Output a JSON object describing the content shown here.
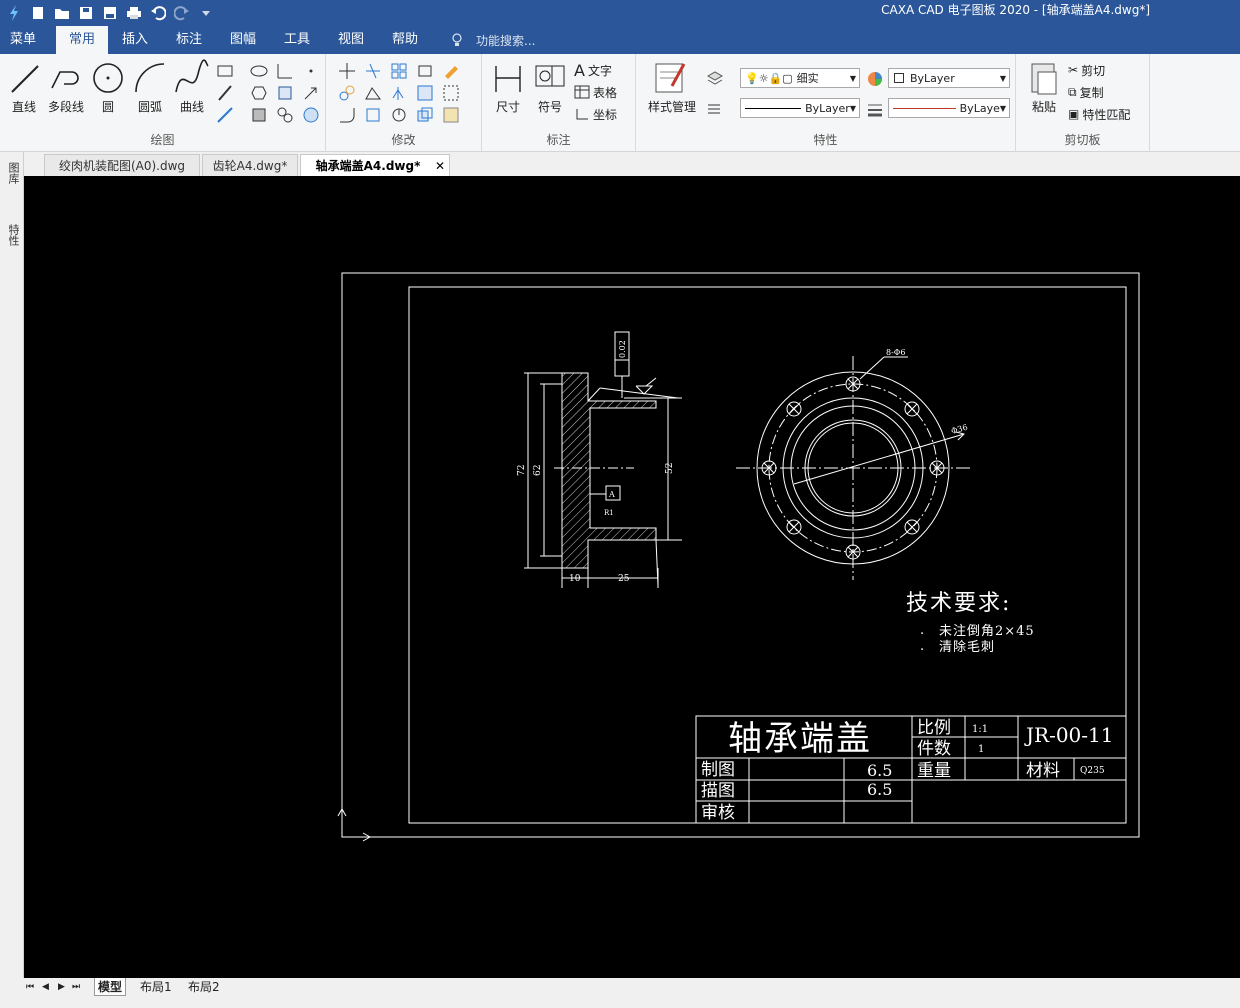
{
  "window": {
    "title": "CAXA CAD 电子图板 2020 - [轴承端盖A4.dwg*]"
  },
  "menu": {
    "items": [
      "菜单",
      "常用",
      "插入",
      "标注",
      "图幅",
      "工具",
      "视图",
      "帮助"
    ],
    "active": "常用",
    "search_placeholder": "功能搜索..."
  },
  "ribbon": {
    "draw": {
      "label": "绘图",
      "line": "直线",
      "polyline": "多段线",
      "circle": "圆",
      "arc": "圆弧",
      "curve": "曲线"
    },
    "modify": {
      "label": "修改"
    },
    "annotate": {
      "label": "标注",
      "dimension": "尺寸",
      "symbol": "符号",
      "text": "文字",
      "table": "表格",
      "coord": "坐标"
    },
    "properties": {
      "label": "特性",
      "style_manager": "样式管理",
      "layer": "细实",
      "color": "ByLayer",
      "linetype": "ByLayer",
      "lineweight": "ByLaye"
    },
    "clipboard": {
      "label": "剪切板",
      "paste": "粘贴",
      "cut": "剪切",
      "copy": "复制",
      "match": "特性匹配"
    }
  },
  "doc_tabs": [
    "绞肉机装配图(A0).dwg",
    "齿轮A4.dwg*",
    "轴承端盖A4.dwg*"
  ],
  "active_doc": "轴承端盖A4.dwg*",
  "side_tabs": [
    "图库",
    "特性"
  ],
  "drawing": {
    "tech_title": "技术要求:",
    "tech_items": [
      "未注倒角2×45",
      "清除毛刺"
    ],
    "part_name": "轴承端盖",
    "drawing_no": "JR-00-11",
    "scale_label": "比例",
    "scale": "1:1",
    "qty_label": "件数",
    "qty": "1",
    "weight_label": "重量",
    "material_label": "材料",
    "material": "Q235",
    "drawn_label": "制图",
    "drawn_val": "6.5",
    "traced_label": "描图",
    "traced_val": "6.5",
    "review_label": "审核",
    "dims": {
      "d72": "72",
      "d62": "62",
      "d52": "52",
      "w10": "10",
      "w25": "25",
      "tol": "0.02",
      "datum": "A",
      "radius": "R1",
      "holes": "8-Φ6",
      "dia": "Φ36"
    }
  },
  "layout_tabs": [
    "模型",
    "布局1",
    "布局2"
  ],
  "active_layout": "模型",
  "colors": {
    "accent": "#2b579a",
    "canvas": "#000000",
    "line": "#ffffff"
  }
}
